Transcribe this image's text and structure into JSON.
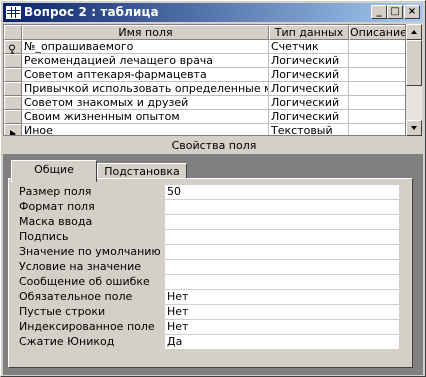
{
  "window": {
    "title": "Вопрос 2 : таблица",
    "controls": [
      "_",
      "□",
      "×"
    ]
  },
  "table": {
    "columns": [
      "Имя поля",
      "Тип данных",
      "Описание"
    ],
    "rows": [
      {
        "name": "№_опрашиваемого",
        "type": "Счетчик",
        "description": "",
        "marker": "key"
      },
      {
        "name": "Рекомендацией лечащего врача",
        "type": "Логический",
        "description": "",
        "marker": ""
      },
      {
        "name": "Советом аптекаря-фармацевта",
        "type": "Логический",
        "description": "",
        "marker": ""
      },
      {
        "name": "Привычкой использовать определенные марки",
        "type": "Логический",
        "description": "",
        "marker": ""
      },
      {
        "name": "Советом знакомых и друзей",
        "type": "Логический",
        "description": "",
        "marker": ""
      },
      {
        "name": "Своим жизненным опытом",
        "type": "Логический",
        "description": "",
        "marker": ""
      },
      {
        "name": "Иное",
        "type": "Текстовый",
        "description": "",
        "marker": "current"
      }
    ]
  },
  "properties": {
    "title": "Свойства поля",
    "tabs": [
      "Общие",
      "Подстановка"
    ],
    "active_tab": "Общие",
    "items": [
      {
        "label": "Размер поля",
        "value": "50"
      },
      {
        "label": "Формат поля",
        "value": ""
      },
      {
        "label": "Маска ввода",
        "value": ""
      },
      {
        "label": "Подпись",
        "value": ""
      },
      {
        "label": "Значение по умолчанию",
        "value": ""
      },
      {
        "label": "Условие на значение",
        "value": ""
      },
      {
        "label": "Сообщение об ошибке",
        "value": ""
      },
      {
        "label": "Обязательное поле",
        "value": "Нет"
      },
      {
        "label": "Пустые строки",
        "value": "Нет"
      },
      {
        "label": "Индексированное поле",
        "value": "Нет"
      },
      {
        "label": "Сжатие Юникод",
        "value": "Да"
      }
    ]
  },
  "icons": {
    "window": "table-icon",
    "key": "primary-key-icon",
    "current_row": "current-row-arrow-icon",
    "scroll_up": "scroll-up-arrow-icon",
    "scroll_down": "scroll-down-arrow-icon"
  }
}
